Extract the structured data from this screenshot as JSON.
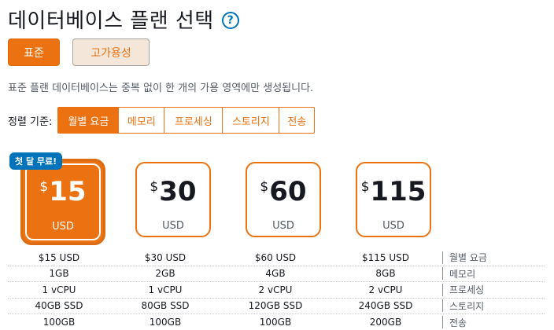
{
  "header": {
    "title": "데이터베이스 플랜 선택",
    "help_icon": "?"
  },
  "tiers": [
    {
      "label": "표준",
      "active": true
    },
    {
      "label": "고가용성",
      "active": false
    }
  ],
  "description": "표준 플랜 데이터베이스는 중복 없이 한 개의 가용 영역에만 생성됩니다.",
  "sort": {
    "label": "정렬 기준:",
    "options": [
      "월별 요금",
      "메모리",
      "프로세싱",
      "스토리지",
      "전송"
    ],
    "selected": "월별 요금"
  },
  "badge": "첫 달 무료!",
  "plans": [
    {
      "currency_symbol": "$",
      "amount": "15",
      "currency": "USD",
      "selected": true
    },
    {
      "currency_symbol": "$",
      "amount": "30",
      "currency": "USD",
      "selected": false
    },
    {
      "currency_symbol": "$",
      "amount": "60",
      "currency": "USD",
      "selected": false
    },
    {
      "currency_symbol": "$",
      "amount": "115",
      "currency": "USD",
      "selected": false
    }
  ],
  "specs": [
    {
      "label": "월별 요금",
      "values": [
        "$15 USD",
        "$30 USD",
        "$60 USD",
        "$115 USD"
      ]
    },
    {
      "label": "메모리",
      "values": [
        "1GB",
        "2GB",
        "4GB",
        "8GB"
      ]
    },
    {
      "label": "프로세싱",
      "values": [
        "1 vCPU",
        "1 vCPU",
        "2 vCPU",
        "2 vCPU"
      ]
    },
    {
      "label": "스토리지",
      "values": [
        "40GB SSD",
        "80GB SSD",
        "120GB SSD",
        "240GB SSD"
      ]
    },
    {
      "label": "전송",
      "values": [
        "100GB",
        "100GB",
        "100GB",
        "200GB"
      ]
    }
  ],
  "colors": {
    "accent": "#ec7211",
    "info": "#0073bb",
    "text": "#16191f",
    "muted": "#545b64"
  }
}
